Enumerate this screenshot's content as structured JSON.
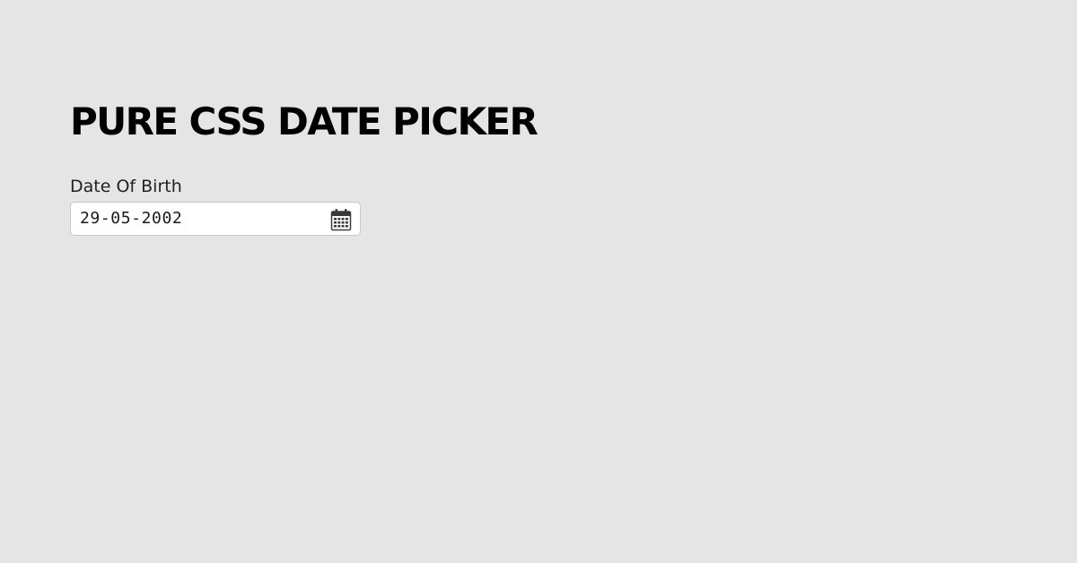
{
  "page": {
    "title": "PURE CSS DATE PICKER",
    "background_color": "#e5e5e5"
  },
  "date_field": {
    "label": "Date Of Birth",
    "value": "29-05-2002",
    "icon": "calendar-icon"
  }
}
